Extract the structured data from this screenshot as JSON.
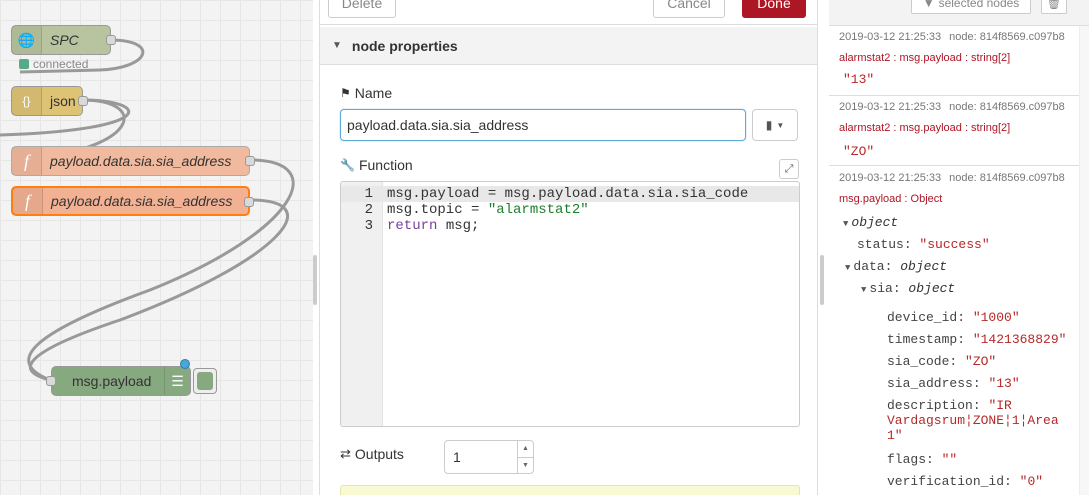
{
  "workspace": {
    "nodes": [
      {
        "label": "SPC",
        "icon": "globe-icon",
        "color": "#b8c49f",
        "status": "connected"
      },
      {
        "label": "json",
        "icon": "braces-icon",
        "color": "#dec375"
      },
      {
        "label": "payload.data.sia.sia_address",
        "icon": "function-icon",
        "color": "#f1b99d"
      },
      {
        "label": "payload.data.sia.sia_address",
        "icon": "function-icon",
        "color": "#f2b193"
      },
      {
        "label": "msg.payload",
        "icon": "list-icon",
        "color": "#87a980"
      }
    ]
  },
  "tray": {
    "buttons": {
      "delete": "Delete",
      "cancel": "Cancel",
      "done": "Done"
    },
    "section": "node properties",
    "name_label": "Name",
    "name_value": "payload.data.sia.sia_address",
    "function_label": "Function",
    "code": [
      {
        "n": "1",
        "parts": [
          [
            "plain",
            "msg.payload = msg.payload.data.sia.sia_code"
          ]
        ]
      },
      {
        "n": "2",
        "parts": [
          [
            "plain",
            "msg.topic = "
          ],
          [
            "str",
            "\"alarmstat2\""
          ]
        ]
      },
      {
        "n": "3",
        "parts": [
          [
            "kw",
            "return"
          ],
          [
            "plain",
            " msg;"
          ]
        ]
      }
    ],
    "outputs_label": "Outputs",
    "outputs_value": "1"
  },
  "sidebar": {
    "filter_label": "selected nodes",
    "messages": [
      {
        "time": "2019-03-12 21:25:33",
        "node": "node: 814f8569.c097b8",
        "topic": "alarmstat2 : msg.payload : string[2]",
        "value": "\"13\""
      },
      {
        "time": "2019-03-12 21:25:33",
        "node": "node: 814f8569.c097b8",
        "topic": "alarmstat2 : msg.payload : string[2]",
        "value": "\"ZO\""
      },
      {
        "time": "2019-03-12 21:25:33",
        "node": "node: 814f8569.c097b8",
        "topic": "msg.payload : Object"
      }
    ],
    "tree": {
      "root": "object",
      "status_key": "status",
      "status_val": "\"success\"",
      "data_key": "data",
      "data_type": "object",
      "sia_key": "sia",
      "sia_type": "object",
      "fields": [
        {
          "k": "device_id",
          "v": "\"1000\""
        },
        {
          "k": "timestamp",
          "v": "\"1421368829\""
        },
        {
          "k": "sia_code",
          "v": "\"ZO\""
        },
        {
          "k": "sia_address",
          "v": "\"13\""
        },
        {
          "k": "description",
          "v": "\"IR"
        },
        {
          "k": "",
          "v": "Vardagsrum¦ZONE¦1¦Area"
        },
        {
          "k": "",
          "v": "1\""
        },
        {
          "k": "flags",
          "v": "\"\""
        },
        {
          "k": "verification_id",
          "v": "\"0\""
        }
      ]
    }
  }
}
